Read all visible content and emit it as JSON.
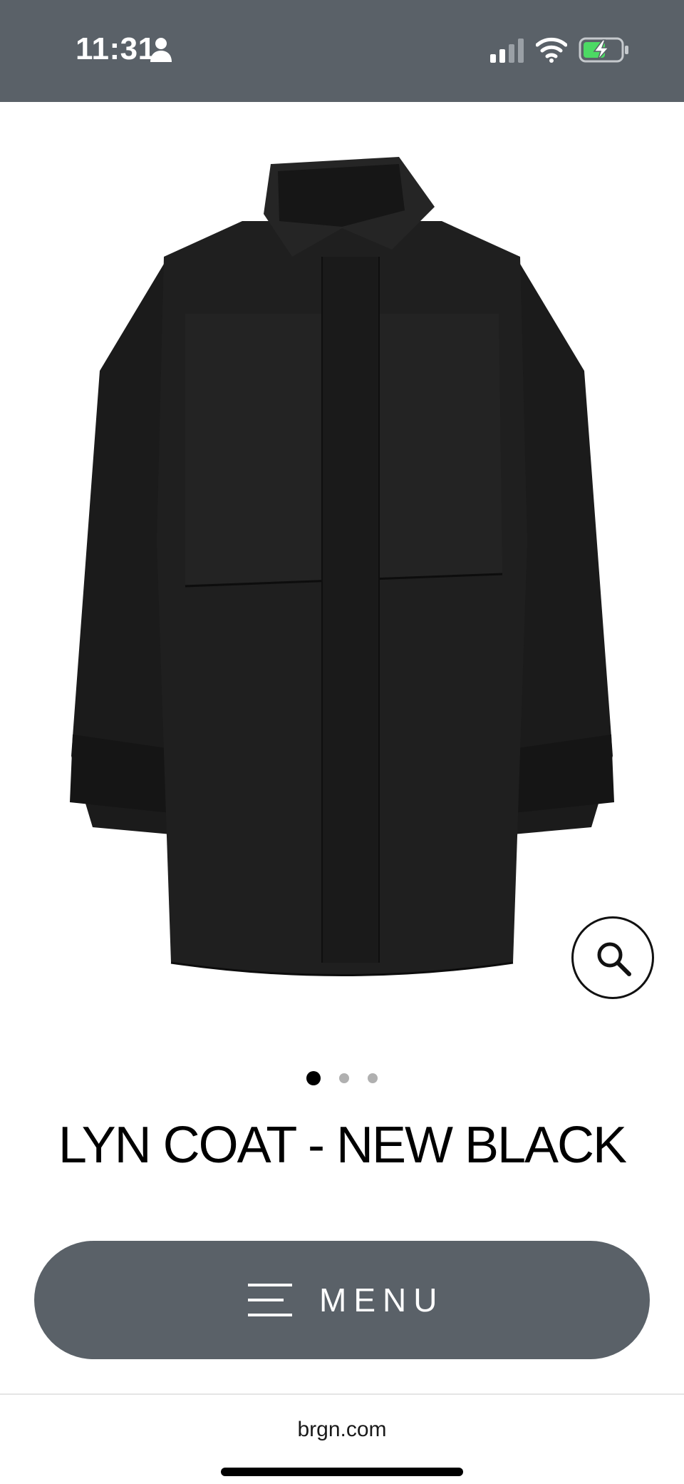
{
  "status_bar": {
    "time": "11:31",
    "icons": [
      "person-icon",
      "signal-icon",
      "wifi-icon",
      "battery-charging-icon"
    ],
    "background_color": "#5a6168",
    "battery_accent_color": "#4cd964"
  },
  "product": {
    "title": "LYN COAT - NEW BLACK",
    "image": "black-coat-product-photo",
    "zoom_icon": "search-icon"
  },
  "carousel": {
    "total_slides": 3,
    "active_index": 0
  },
  "menu_button": {
    "label": "MENU",
    "icon": "hamburger-icon",
    "background_color": "#5a6168"
  },
  "browser": {
    "url": "brgn.com"
  }
}
